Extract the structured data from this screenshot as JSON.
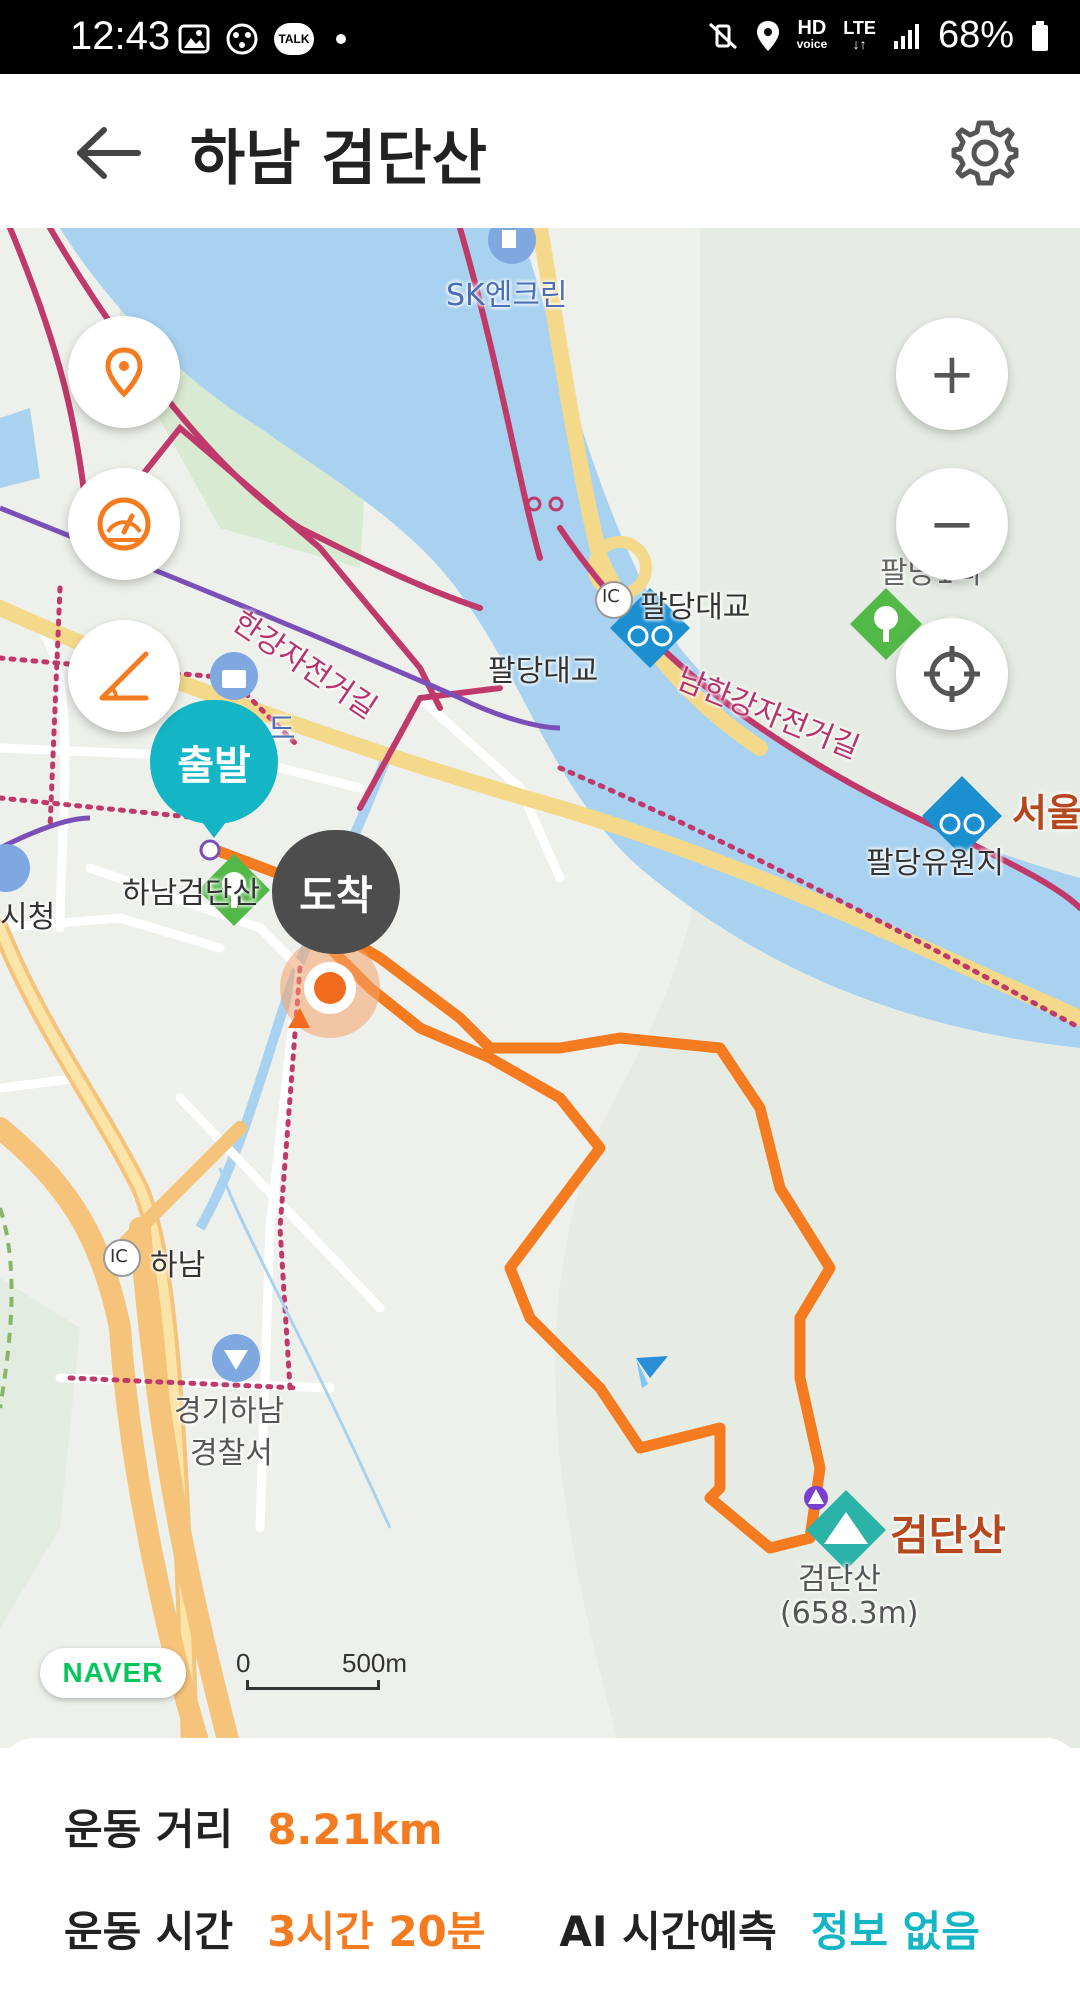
{
  "status_bar": {
    "time": "12:43",
    "notification_icons": [
      "gallery-icon",
      "app-icon",
      "talk-icon",
      "dot-icon"
    ],
    "talk_badge": "TALK",
    "hd_label": "HD",
    "voice_label": "voice",
    "lte_label": "LTE",
    "battery": "68%"
  },
  "header": {
    "title": "하남 검단산",
    "back_icon": "back-arrow-icon",
    "settings_icon": "gear-icon"
  },
  "map": {
    "labels": {
      "sk": "SK엔크린",
      "bike_path_1": "한강자전거길",
      "ic_badge": "IC",
      "paldang_bridge_top": "팔당대교",
      "paldang_bridge": "팔당대교",
      "namhan_bike": "남한강자전거길",
      "paldang_upper": "팔당1리",
      "seoul": "서울",
      "paldang_park": "팔당유원지",
      "hanam_geomdan": "하남검단산",
      "city_hall": "시청",
      "ic_hanam": "하남",
      "police_1": "경기하남",
      "police_2": "경찰서",
      "peak_bold": "검단산",
      "peak_small": "검단산",
      "peak_height": "(658.3m)",
      "partial_place": "드"
    },
    "markers": {
      "start": "출발",
      "end": "도착"
    },
    "controls": {
      "zoom_in": "+",
      "zoom_out": "−"
    },
    "attribution": "NAVER",
    "scale": {
      "zero": "0",
      "distance": "500m"
    },
    "colors": {
      "route": "#f47b20",
      "river": "#a8d2f0",
      "start_marker": "#14b5c4",
      "end_marker": "#4d4d4d",
      "bike_path": "#c0396b",
      "highway": "#f5c37a"
    }
  },
  "summary": {
    "distance_label": "운동 거리",
    "distance_value": "8.21km",
    "time_label": "운동 시간",
    "time_value": "3시간 20분",
    "ai_label": "AI 시간예측",
    "ai_value": "정보 없음"
  }
}
